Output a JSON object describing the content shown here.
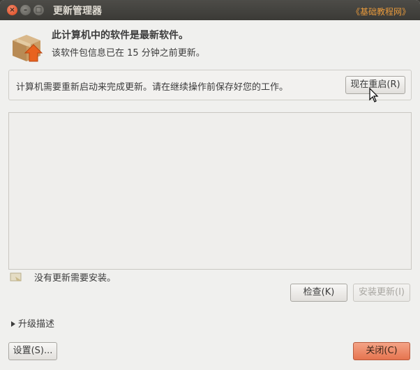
{
  "window": {
    "title": "更新管理器",
    "watermark": "《基础教程网》",
    "close_glyph": "×",
    "minimize_glyph": "–",
    "maximize_glyph": "□"
  },
  "header": {
    "title": "此计算机中的软件是最新软件。",
    "subtitle": "该软件包信息已在 15 分钟之前更新。"
  },
  "infobar": {
    "message": "计算机需要重新启动来完成更新。请在继续操作前保存好您的工作。",
    "restart_label": "现在重启(R)"
  },
  "status": {
    "message": "没有更新需要安装。"
  },
  "actions": {
    "check_label": "检查(K)",
    "install_label": "安装更新(I)"
  },
  "expander": {
    "label": "升级描述"
  },
  "footer": {
    "settings_label": "设置(S)...",
    "close_label": "关闭(C)"
  },
  "colors": {
    "accent": "#e6744f",
    "titlebar": "#3c3b37",
    "watermark": "#e89a3c"
  },
  "icons": [
    "package-icon",
    "arrow-up-icon",
    "status-icon",
    "mouse-cursor-icon",
    "expander-arrow-icon"
  ]
}
